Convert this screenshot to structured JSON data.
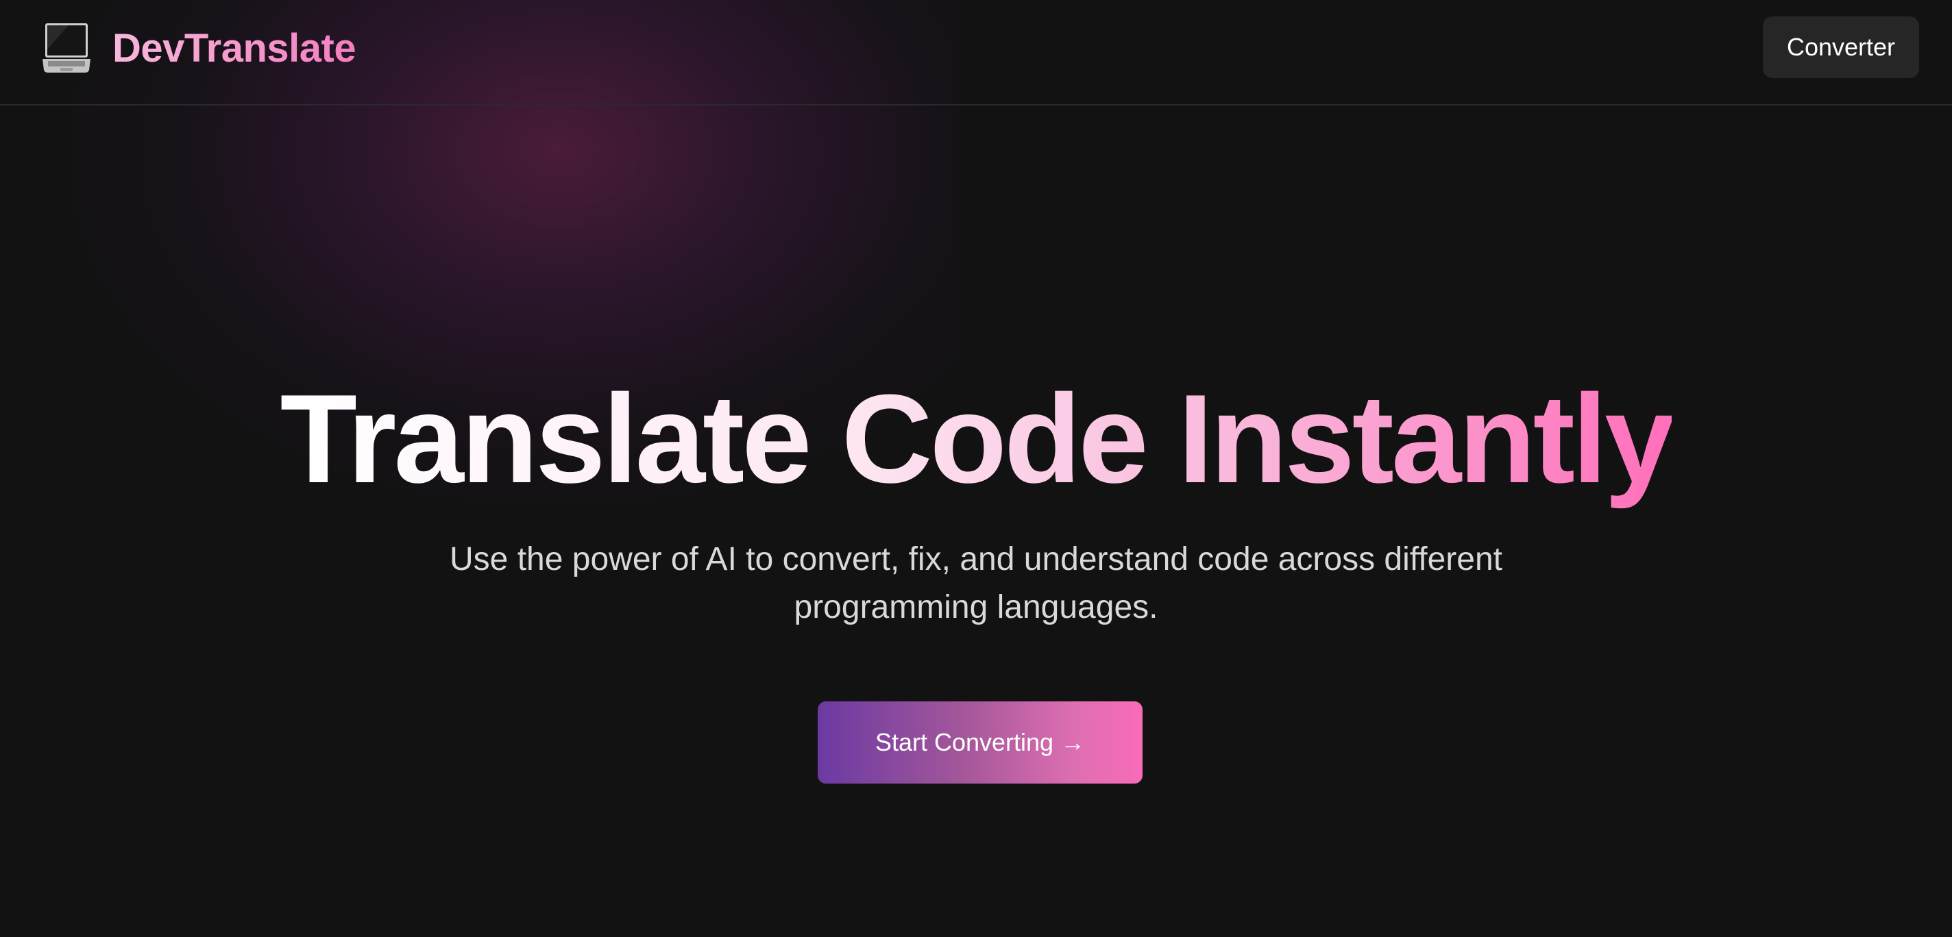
{
  "brand": {
    "icon": "laptop-icon",
    "name": "DevTranslate"
  },
  "nav": {
    "converter_label": "Converter"
  },
  "hero": {
    "title": "Translate Code Instantly",
    "subtitle": "Use the power of AI to convert, fix, and understand code across different programming languages.",
    "cta_label": "Start Converting →"
  },
  "colors": {
    "background": "#121212",
    "brand_gradient_start": "#f9b7dc",
    "brand_gradient_end": "#f47ec0",
    "nav_button_bg": "#262626",
    "cta_gradient_start": "#6b3aa2",
    "cta_gradient_end": "#f96bb8",
    "subtitle_text": "#d9d9d9"
  }
}
